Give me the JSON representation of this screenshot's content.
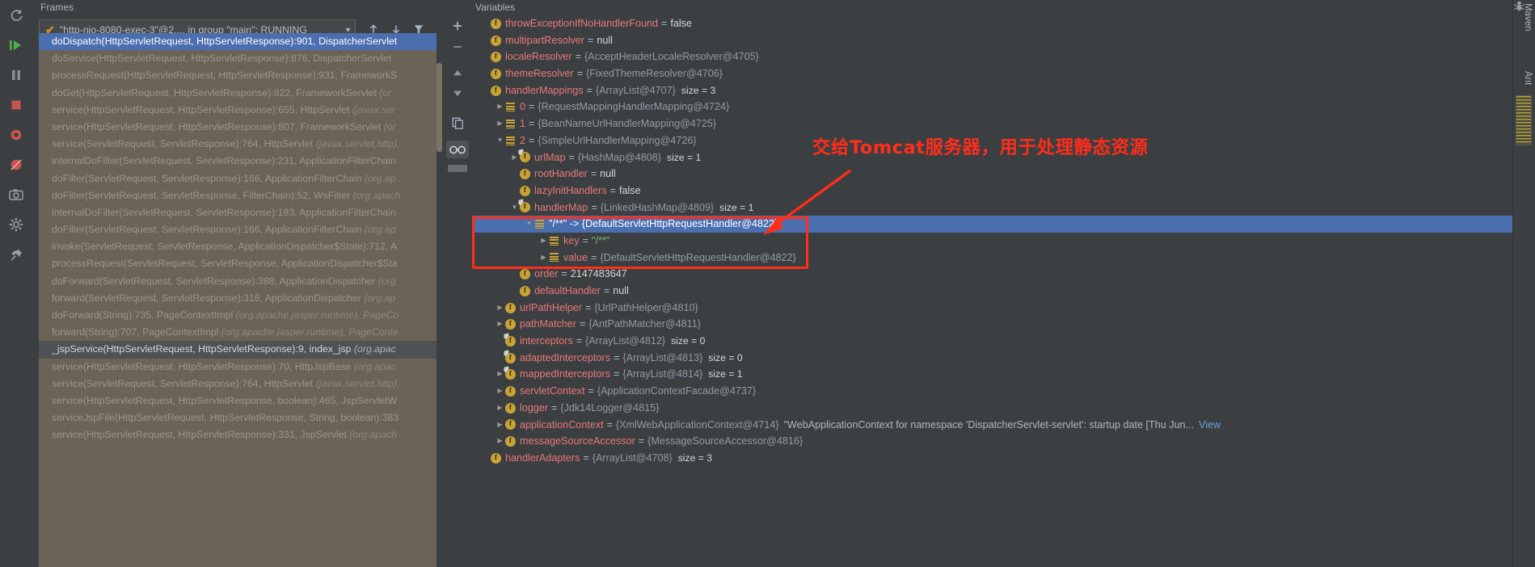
{
  "frames": {
    "title": "Frames",
    "thread_selector": {
      "check_icon": "orange-check",
      "label": "\"http-nio-8080-exec-3\"@2,... in group \"main\": RUNNING",
      "dropdown_icon": "chevron-down-icon"
    },
    "toolbar": {
      "up_icon": "arrow-up-icon",
      "down_icon": "arrow-down-icon",
      "filter_icon": "filter-icon"
    },
    "rows": [
      {
        "text": "doDispatch(HttpServletRequest, HttpServletResponse):901, DispatcherServlet",
        "pkg": "",
        "state": "selected"
      },
      {
        "text": "doService(HttpServletRequest, HttpServletResponse):876, DispatcherServlet",
        "pkg": "",
        "state": "normal"
      },
      {
        "text": "processRequest(HttpServletRequest, HttpServletResponse):931, FrameworkS",
        "pkg": "",
        "state": "normal"
      },
      {
        "text": "doGet(HttpServletRequest, HttpServletResponse):822, FrameworkServlet ",
        "pkg": "(or",
        "state": "normal"
      },
      {
        "text": "service(HttpServletRequest, HttpServletResponse):655, HttpServlet ",
        "pkg": "(javax.ser",
        "state": "normal"
      },
      {
        "text": "service(HttpServletRequest, HttpServletResponse):807, FrameworkServlet ",
        "pkg": "(or",
        "state": "normal"
      },
      {
        "text": "service(ServletRequest, ServletResponse):764, HttpServlet ",
        "pkg": "(javax.servlet.http),",
        "state": "normal"
      },
      {
        "text": "internalDoFilter(ServletRequest, ServletResponse):231, ApplicationFilterChain",
        "pkg": "",
        "state": "normal"
      },
      {
        "text": "doFilter(ServletRequest, ServletResponse):166, ApplicationFilterChain ",
        "pkg": "(org.ap",
        "state": "normal"
      },
      {
        "text": "doFilter(ServletRequest, ServletResponse, FilterChain):52, WsFilter ",
        "pkg": "(org.apach",
        "state": "normal"
      },
      {
        "text": "internalDoFilter(ServletRequest, ServletResponse):193, ApplicationFilterChain",
        "pkg": "",
        "state": "normal"
      },
      {
        "text": "doFilter(ServletRequest, ServletResponse):166, ApplicationFilterChain ",
        "pkg": "(org.ap",
        "state": "normal"
      },
      {
        "text": "invoke(ServletRequest, ServletResponse, ApplicationDispatcher$State):712, A",
        "pkg": "",
        "state": "normal"
      },
      {
        "text": "processRequest(ServletRequest, ServletResponse, ApplicationDispatcher$Sta",
        "pkg": "",
        "state": "normal"
      },
      {
        "text": "doForward(ServletRequest, ServletResponse):388, ApplicationDispatcher ",
        "pkg": "(org",
        "state": "normal"
      },
      {
        "text": "forward(ServletRequest, ServletResponse):316, ApplicationDispatcher ",
        "pkg": "(org.ap",
        "state": "normal"
      },
      {
        "text": "doForward(String):735, PageContextImpl ",
        "pkg": "(org.apache.jasper.runtime), PageCo",
        "state": "normal"
      },
      {
        "text": "forward(String):707, PageContextImpl ",
        "pkg": "(org.apache.jasper.runtime), PageConte",
        "state": "normal"
      },
      {
        "text": "_jspService(HttpServletRequest, HttpServletResponse):9, index_jsp ",
        "pkg": "(org.apac",
        "state": "current"
      },
      {
        "text": "service(HttpServletRequest, HttpServletResponse):70, HttpJspBase ",
        "pkg": "(org.apac",
        "state": "normal"
      },
      {
        "text": "service(ServletRequest, ServletResponse):764, HttpServlet ",
        "pkg": "(javax.servlet.http),",
        "state": "normal"
      },
      {
        "text": "service(HttpServletRequest, HttpServletResponse, boolean):465, JspServletW",
        "pkg": "",
        "state": "normal"
      },
      {
        "text": "serviceJspFile(HttpServletRequest, HttpServletResponse, String, boolean):383",
        "pkg": "",
        "state": "normal"
      },
      {
        "text": "service(HttpServletRequest, HttpServletResponse):331, JspServlet ",
        "pkg": "(org.apach",
        "state": "normal"
      }
    ]
  },
  "vars_toolbar": {
    "add_icon": "plus-icon",
    "remove_icon": "minus-icon",
    "up_icon": "triangle-up-icon",
    "down_icon": "triangle-down-icon",
    "copy_icon": "copy-icon",
    "watch_icon": "glasses-icon"
  },
  "variables": {
    "title": "Variables",
    "rows": [
      {
        "indent": 0,
        "tri": "none",
        "badge": "f",
        "name": "throwExceptionIfNoHandlerFound",
        "eq": "=",
        "value": "false",
        "vtype": "num",
        "size": "",
        "state": "normal"
      },
      {
        "indent": 0,
        "tri": "none",
        "badge": "f",
        "name": "multipartResolver",
        "eq": "=",
        "value": "null",
        "vtype": "num",
        "size": "",
        "state": "normal"
      },
      {
        "indent": 0,
        "tri": "none",
        "badge": "f",
        "name": "localeResolver",
        "eq": "=",
        "value": "{AcceptHeaderLocaleResolver@4705}",
        "vtype": "obj",
        "size": "",
        "state": "normal"
      },
      {
        "indent": 0,
        "tri": "none",
        "badge": "f",
        "name": "themeResolver",
        "eq": "=",
        "value": "{FixedThemeResolver@4706}",
        "vtype": "obj",
        "size": "",
        "state": "normal"
      },
      {
        "indent": 0,
        "tri": "none",
        "badge": "f",
        "name": "handlerMappings",
        "eq": "=",
        "value": "{ArrayList@4707}",
        "vtype": "obj",
        "size": "size = 3",
        "state": "normal"
      },
      {
        "indent": 1,
        "tri": "right",
        "badge": "li",
        "name": "0",
        "eq": "=",
        "value": "{RequestMappingHandlerMapping@4724}",
        "vtype": "obj",
        "size": "",
        "state": "normal"
      },
      {
        "indent": 1,
        "tri": "right",
        "badge": "li",
        "name": "1",
        "eq": "=",
        "value": "{BeanNameUrlHandlerMapping@4725}",
        "vtype": "obj",
        "size": "",
        "state": "normal"
      },
      {
        "indent": 1,
        "tri": "down",
        "badge": "li",
        "name": "2",
        "eq": "=",
        "value": "{SimpleUrlHandlerMapping@4726}",
        "vtype": "obj",
        "size": "",
        "state": "normal"
      },
      {
        "indent": 2,
        "tri": "right",
        "badge": "f-mod",
        "name": "urlMap",
        "eq": "=",
        "value": "{HashMap@4808}",
        "vtype": "obj",
        "size": "size = 1",
        "state": "normal"
      },
      {
        "indent": 2,
        "tri": "none",
        "badge": "f",
        "name": "rootHandler",
        "eq": "=",
        "value": "null",
        "vtype": "num",
        "size": "",
        "state": "normal"
      },
      {
        "indent": 2,
        "tri": "none",
        "badge": "f",
        "name": "lazyInitHandlers",
        "eq": "=",
        "value": "false",
        "vtype": "num",
        "size": "",
        "state": "normal"
      },
      {
        "indent": 2,
        "tri": "down",
        "badge": "f-mod",
        "name": "handlerMap",
        "eq": "=",
        "value": "{LinkedHashMap@4809}",
        "vtype": "obj",
        "size": "size = 1",
        "state": "normal"
      },
      {
        "indent": 3,
        "tri": "down",
        "badge": "li",
        "name": "\"/**\" -> {DefaultServletHttpRequestHandler@4822}",
        "eq": "",
        "value": "",
        "vtype": "obj",
        "size": "",
        "state": "selected"
      },
      {
        "indent": 4,
        "tri": "right",
        "badge": "li",
        "name": "key",
        "eq": "=",
        "value": "\"/**\"",
        "vtype": "str",
        "size": "",
        "state": "normal"
      },
      {
        "indent": 4,
        "tri": "right",
        "badge": "li",
        "name": "value",
        "eq": "=",
        "value": "{DefaultServletHttpRequestHandler@4822}",
        "vtype": "obj",
        "size": "",
        "state": "normal"
      },
      {
        "indent": 2,
        "tri": "none",
        "badge": "f",
        "name": "order",
        "eq": "=",
        "value": "2147483647",
        "vtype": "num",
        "size": "",
        "state": "normal"
      },
      {
        "indent": 2,
        "tri": "none",
        "badge": "f",
        "name": "defaultHandler",
        "eq": "=",
        "value": "null",
        "vtype": "num",
        "size": "",
        "state": "normal"
      },
      {
        "indent": 1,
        "tri": "right",
        "badge": "f",
        "name": "urlPathHelper",
        "eq": "=",
        "value": "{UrlPathHelper@4810}",
        "vtype": "obj",
        "size": "",
        "state": "normal"
      },
      {
        "indent": 1,
        "tri": "right",
        "badge": "f",
        "name": "pathMatcher",
        "eq": "=",
        "value": "{AntPathMatcher@4811}",
        "vtype": "obj",
        "size": "",
        "state": "normal"
      },
      {
        "indent": 1,
        "tri": "none",
        "badge": "f-mod",
        "name": "interceptors",
        "eq": "=",
        "value": "{ArrayList@4812}",
        "vtype": "obj",
        "size": "size = 0",
        "state": "normal"
      },
      {
        "indent": 1,
        "tri": "none",
        "badge": "f-mod",
        "name": "adaptedInterceptors",
        "eq": "=",
        "value": "{ArrayList@4813}",
        "vtype": "obj",
        "size": "size = 0",
        "state": "normal"
      },
      {
        "indent": 1,
        "tri": "right",
        "badge": "f-mod",
        "name": "mappedInterceptors",
        "eq": "=",
        "value": "{ArrayList@4814}",
        "vtype": "obj",
        "size": "size = 1",
        "state": "normal"
      },
      {
        "indent": 1,
        "tri": "right",
        "badge": "f",
        "name": "servletContext",
        "eq": "=",
        "value": "{ApplicationContextFacade@4737}",
        "vtype": "obj",
        "size": "",
        "state": "normal"
      },
      {
        "indent": 1,
        "tri": "right",
        "badge": "f",
        "name": "logger",
        "eq": "=",
        "value": "{Jdk14Logger@4815}",
        "vtype": "obj",
        "size": "",
        "state": "normal"
      },
      {
        "indent": 1,
        "tri": "right",
        "badge": "f",
        "name": "applicationContext",
        "eq": "=",
        "value": "{XmlWebApplicationContext@4714}",
        "vtype": "obj",
        "size": "",
        "extra": "\"WebApplicationContext for namespace 'DispatcherServlet-servlet': startup date [Thu Jun...",
        "link": "View",
        "state": "normal"
      },
      {
        "indent": 1,
        "tri": "right",
        "badge": "f",
        "name": "messageSourceAccessor",
        "eq": "=",
        "value": "{MessageSourceAccessor@4816}",
        "vtype": "obj",
        "size": "",
        "state": "normal"
      },
      {
        "indent": 0,
        "tri": "none",
        "badge": "f",
        "name": "handlerAdapters",
        "eq": "=",
        "value": "{ArrayList@4708}",
        "vtype": "obj",
        "size": "size = 3",
        "state": "normal"
      }
    ]
  },
  "annotation": {
    "text": "交给Tomcat服务器，用于处理静态资源",
    "color": "#ff2d1a",
    "arrow_icon": "arrow-pointer-icon",
    "box_label": "red-highlight-box"
  },
  "left_strip": {
    "icons": [
      "rerun-icon",
      "resume-program-icon",
      "pause-icon",
      "stop-icon",
      "mute-breakpoints-icon",
      "view-breakpoints-icon",
      "screenshot-icon",
      "settings-icon",
      "pin-icon"
    ]
  },
  "right_strip": {
    "maven_label": "Maven",
    "ant_label": "Ant",
    "ant_icon": "ant-icon",
    "minimap_icon": "minimap-icon"
  }
}
